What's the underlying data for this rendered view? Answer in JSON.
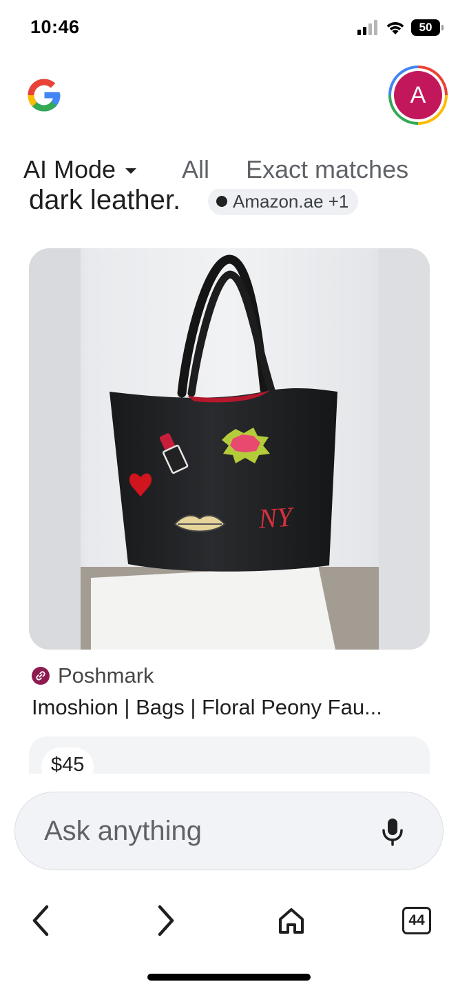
{
  "status_bar": {
    "time": "10:46",
    "battery": "50"
  },
  "header": {
    "avatar_letter": "A"
  },
  "tabs": [
    {
      "label": "AI Mode"
    },
    {
      "label": "All"
    },
    {
      "label": "Exact matches"
    }
  ],
  "partial_text": "dark leather.",
  "partial_chip": "Amazon.ae +1",
  "product": {
    "source": "Poshmark",
    "title": "Imoshion | Bags | Floral Peony Fau...",
    "price": "$45",
    "patch_text": "NY"
  },
  "ask_bar": {
    "placeholder": "Ask anything"
  },
  "bottom_nav": {
    "tab_count": "44"
  }
}
